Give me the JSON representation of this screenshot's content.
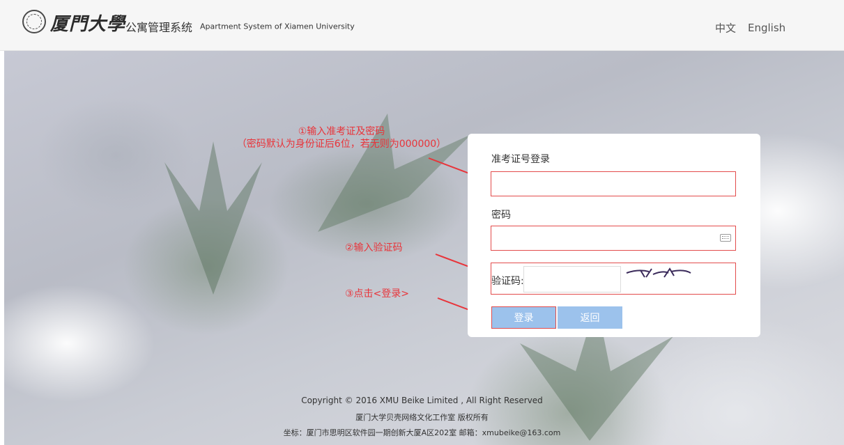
{
  "header": {
    "university_name": "厦門大學",
    "system_name_cn": "公寓管理系统",
    "system_name_en": "Apartment System of Xiamen University",
    "lang_zh": "中文",
    "lang_en": "English"
  },
  "annotations": {
    "step1_line1": "①输入准考证及密码",
    "step1_line2": "（密码默认为身份证后6位，若无则为000000）",
    "step2": "②输入验证码",
    "step3": "③点击<登录>"
  },
  "login": {
    "id_label": "准考证号登录",
    "id_value": "",
    "password_label": "密码",
    "password_value": "",
    "captcha_label": "验证码:",
    "captcha_value": "",
    "login_button": "登录",
    "back_button": "返回"
  },
  "footer": {
    "copyright": "Copyright © 2016 XMU Beike Limited , All Right Reserved",
    "studio": "厦门大学贝壳网络文化工作室   版权所有",
    "address": "坐标：厦门市思明区软件园一期创新大厦A区202室    邮箱：xmubeike@163.com"
  },
  "colors": {
    "annotation": "#e8343a",
    "button": "#9cc2ec",
    "highlight_border": "#e34b4b"
  }
}
